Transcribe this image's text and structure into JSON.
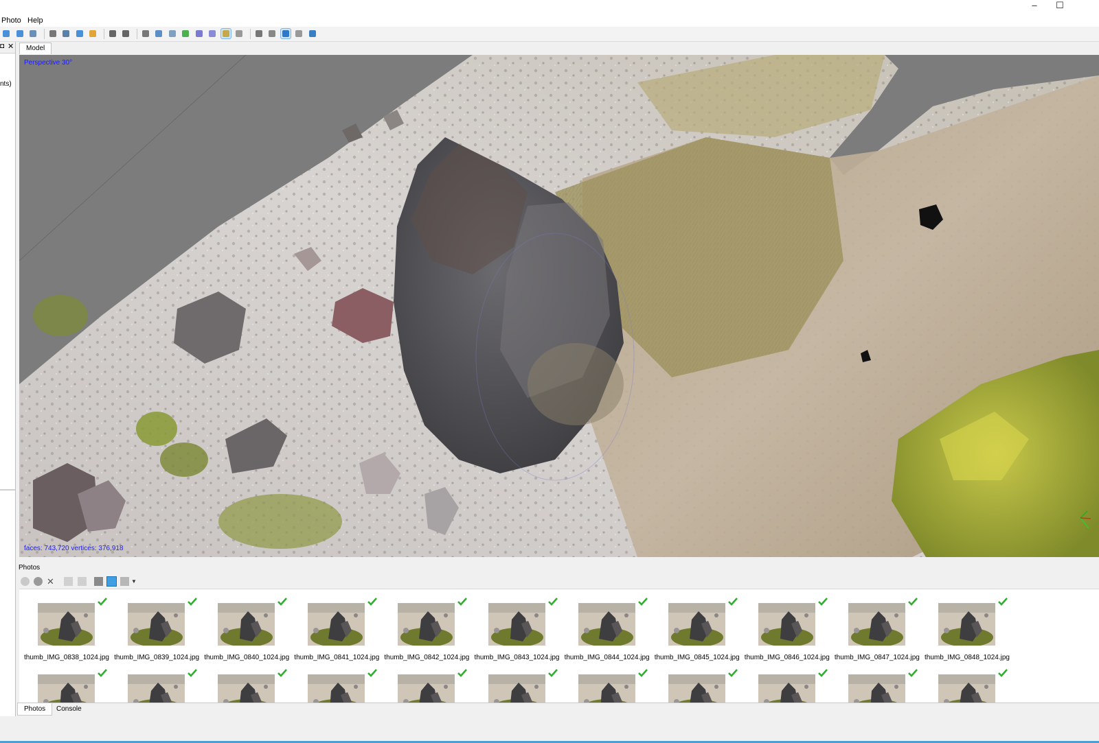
{
  "titlebar": {
    "minimize_glyph": "–",
    "maximize_glyph": "☐"
  },
  "menubar": {
    "items": [
      "Photo",
      "Help"
    ]
  },
  "toolbar": {
    "icons": [
      "navigation-icon",
      "rotate-object-icon",
      "move-object-icon",
      "separator",
      "set-marker-icon",
      "ruler-point-icon",
      "draw-polygon-icon",
      "ruler-icon",
      "separator",
      "delete-icon",
      "crop-icon",
      "separator",
      "grid-icon",
      "dense-cloud-icon",
      "point-classes-icon",
      "shaded-model-icon",
      "solid-model-icon",
      "wireframe-icon",
      "textured-model-icon",
      "tiled-model-icon",
      "separator",
      "show-cameras-icon",
      "show-shapes-icon",
      "show-markers-icon",
      "show-region-icon",
      "reset-view-icon"
    ]
  },
  "left_panel": {
    "fragment_text": "nts)"
  },
  "tabs": {
    "model": "Model"
  },
  "viewport": {
    "projection_label": "Perspective 30°",
    "stats_label": "faces: 743,720 vertices: 376,918"
  },
  "photos_panel": {
    "title": "Photos",
    "row1": [
      "thumb_IMG_0838_1024.jpg",
      "thumb_IMG_0839_1024.jpg",
      "thumb_IMG_0840_1024.jpg",
      "thumb_IMG_0841_1024.jpg",
      "thumb_IMG_0842_1024.jpg",
      "thumb_IMG_0843_1024.jpg",
      "thumb_IMG_0844_1024.jpg",
      "thumb_IMG_0845_1024.jpg",
      "thumb_IMG_0846_1024.jpg",
      "thumb_IMG_0847_1024.jpg",
      "thumb_IMG_0848_1024.jpg"
    ],
    "row2_count": 11
  },
  "bottom_tabs": {
    "photos": "Photos",
    "console": "Console"
  },
  "colors": {
    "check": "#2fae2f",
    "viewport_bg": "#7c7c7c",
    "overlay_text": "#1a1aff"
  }
}
